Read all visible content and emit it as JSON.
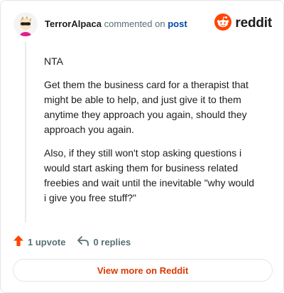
{
  "comment": {
    "author": "TerrorAlpaca",
    "action_text": "commented on",
    "post_link": "post",
    "paragraphs": [
      "NTA",
      "Get them the business card for a therapist that might be able to help, and just give it to them anytime they approach you again, should they approach you again.",
      "Also, if they still won't stop asking questions i would start asking them for business related freebies and wait until the inevitable \"why would i give you free stuff?\""
    ]
  },
  "brand": {
    "name": "reddit",
    "icon": "reddit-logo-icon",
    "color": "#ff4500"
  },
  "actions": {
    "upvote_icon": "upvote-arrow-icon",
    "upvote_label": "1 upvote",
    "replies_icon": "reply-icon",
    "replies_label": "0 replies"
  },
  "cta": {
    "label": "View more on Reddit",
    "color": "#d93900"
  }
}
